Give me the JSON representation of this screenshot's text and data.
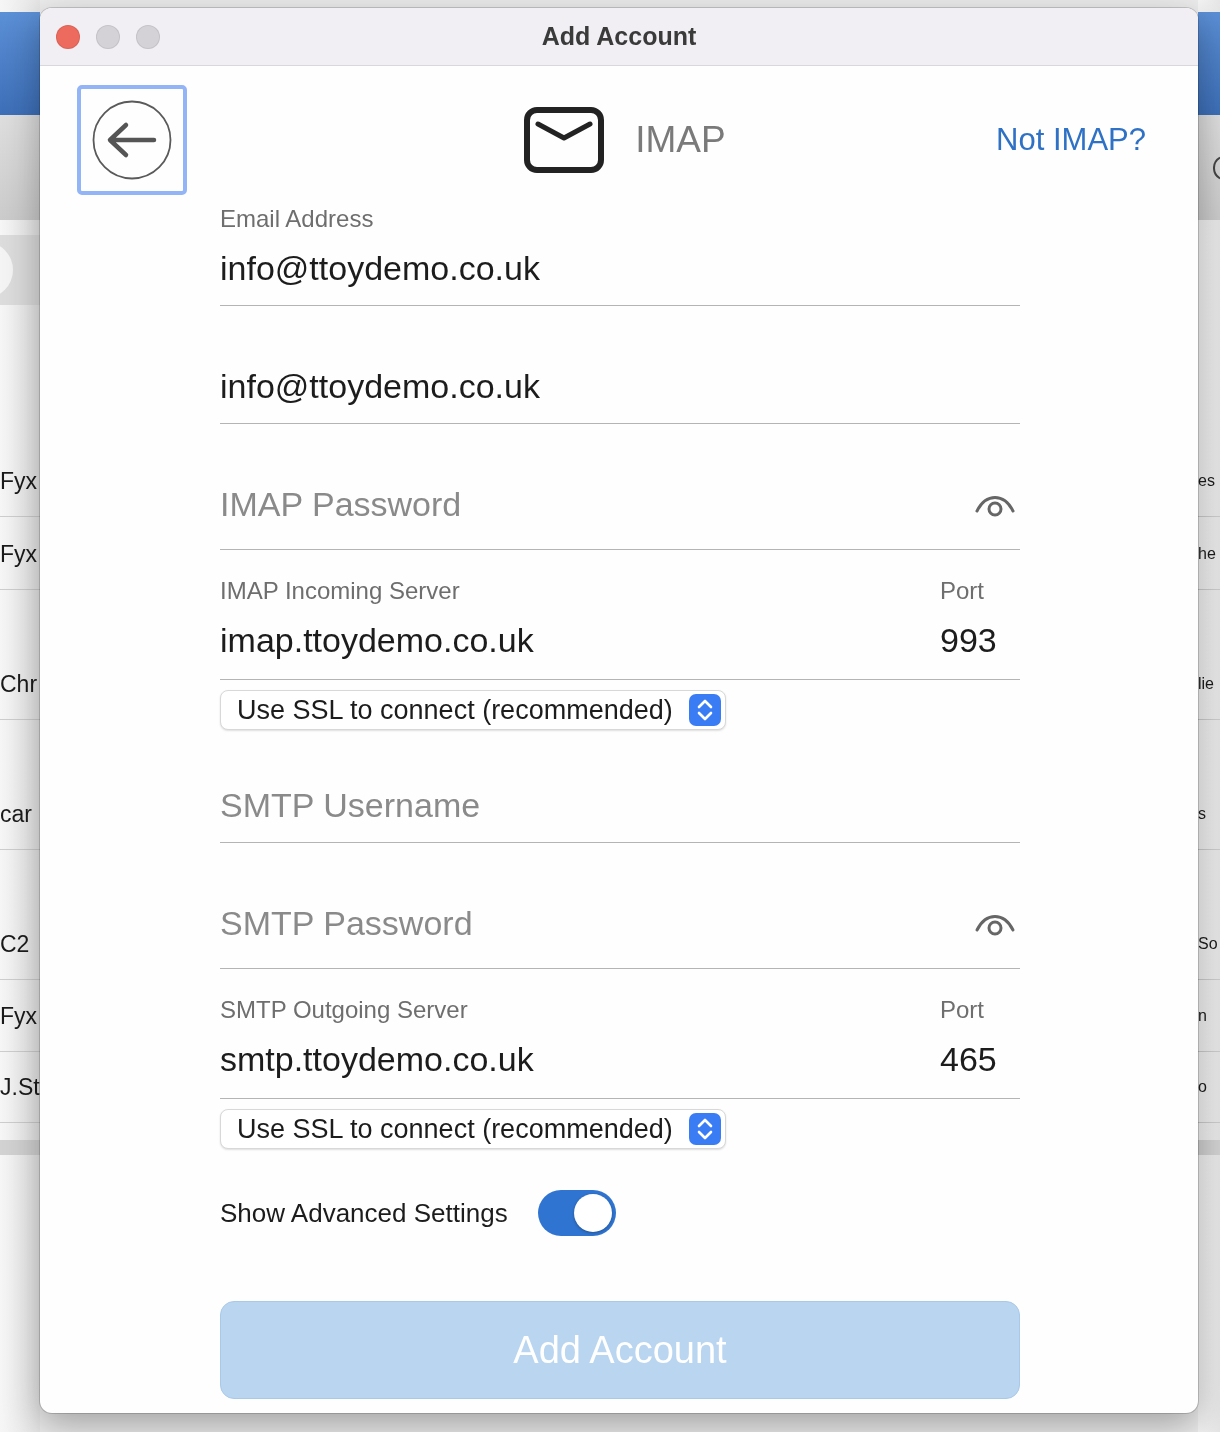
{
  "background_window": {
    "left_items": [
      "Fyx",
      "Fyx",
      "Chr",
      "car",
      "C2",
      "Fyx",
      "J.St"
    ],
    "right_items": [
      "es",
      "he",
      "lie",
      "s",
      "So",
      "n",
      "o"
    ]
  },
  "window": {
    "title": "Add Account",
    "buttons": [
      {
        "kind": "close",
        "disabled": false
      },
      {
        "kind": "minimize",
        "disabled": true
      },
      {
        "kind": "zoom",
        "disabled": true
      }
    ]
  },
  "header": {
    "back_button": {
      "focused": true
    },
    "protocol": "IMAP",
    "switch_link": "Not IMAP?"
  },
  "form": [
    {
      "kind": "text",
      "label": "Email Address",
      "value": "info@ttoydemo.co.uk"
    },
    {
      "kind": "text",
      "value": "info@ttoydemo.co.uk"
    },
    {
      "kind": "password",
      "placeholder": "IMAP Password"
    },
    {
      "kind": "server",
      "label": "IMAP Incoming Server",
      "value": "imap.ttoydemo.co.uk",
      "port_label": "Port",
      "port": "993"
    },
    {
      "kind": "select",
      "value": "Use SSL to connect (recommended)"
    },
    {
      "kind": "text",
      "placeholder": "SMTP Username"
    },
    {
      "kind": "password",
      "placeholder": "SMTP Password"
    },
    {
      "kind": "server",
      "label": "SMTP Outgoing Server",
      "value": "smtp.ttoydemo.co.uk",
      "port_label": "Port",
      "port": "465"
    },
    {
      "kind": "select",
      "value": "Use SSL to connect (recommended)"
    },
    {
      "kind": "toggle",
      "label": "Show Advanced Settings",
      "on": true
    }
  ],
  "submit": {
    "label": "Add Account",
    "disabled": true
  }
}
